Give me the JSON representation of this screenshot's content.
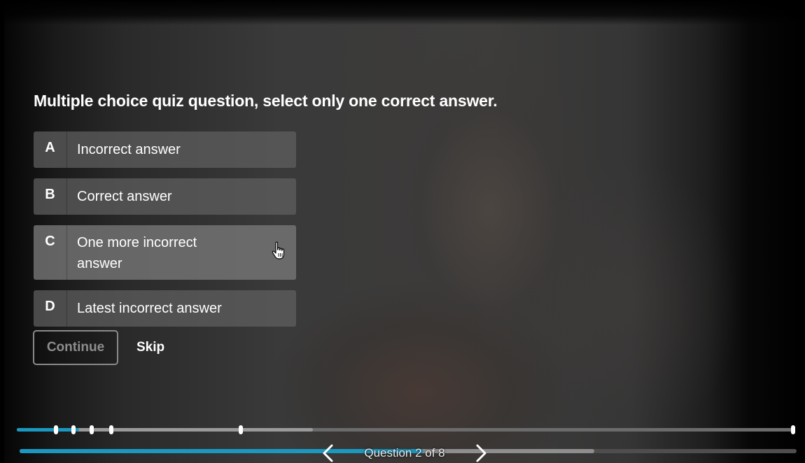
{
  "quiz": {
    "question": "Multiple choice quiz question, select only one correct answer.",
    "options": [
      {
        "letter": "A",
        "text": "Incorrect answer"
      },
      {
        "letter": "B",
        "text": "Correct answer"
      },
      {
        "letter": "C",
        "text": "One more incorrect answer"
      },
      {
        "letter": "D",
        "text": "Latest incorrect answer"
      }
    ],
    "hovered_option": "C",
    "continue_label": "Continue",
    "continue_enabled": false,
    "skip_label": "Skip"
  },
  "progress": {
    "quiz_track_played_fraction": 0.08,
    "quiz_track_buffered_fraction": 0.38,
    "video_played_fraction": 0.52,
    "video_buffered_fraction": 0.74,
    "marker_fractions": [
      0.05,
      0.073,
      0.096,
      0.121,
      0.288,
      1.0
    ]
  },
  "navigation": {
    "counter": "Question 2 of 8",
    "prev_icon": "chevron-left-icon",
    "next_icon": "chevron-right-icon"
  },
  "colors": {
    "accent": "#1a98c0",
    "option_background": "#5f5f5f",
    "disabled_text": "#8d8d8d"
  },
  "icons": {
    "cursor": "hand-pointer-icon"
  }
}
